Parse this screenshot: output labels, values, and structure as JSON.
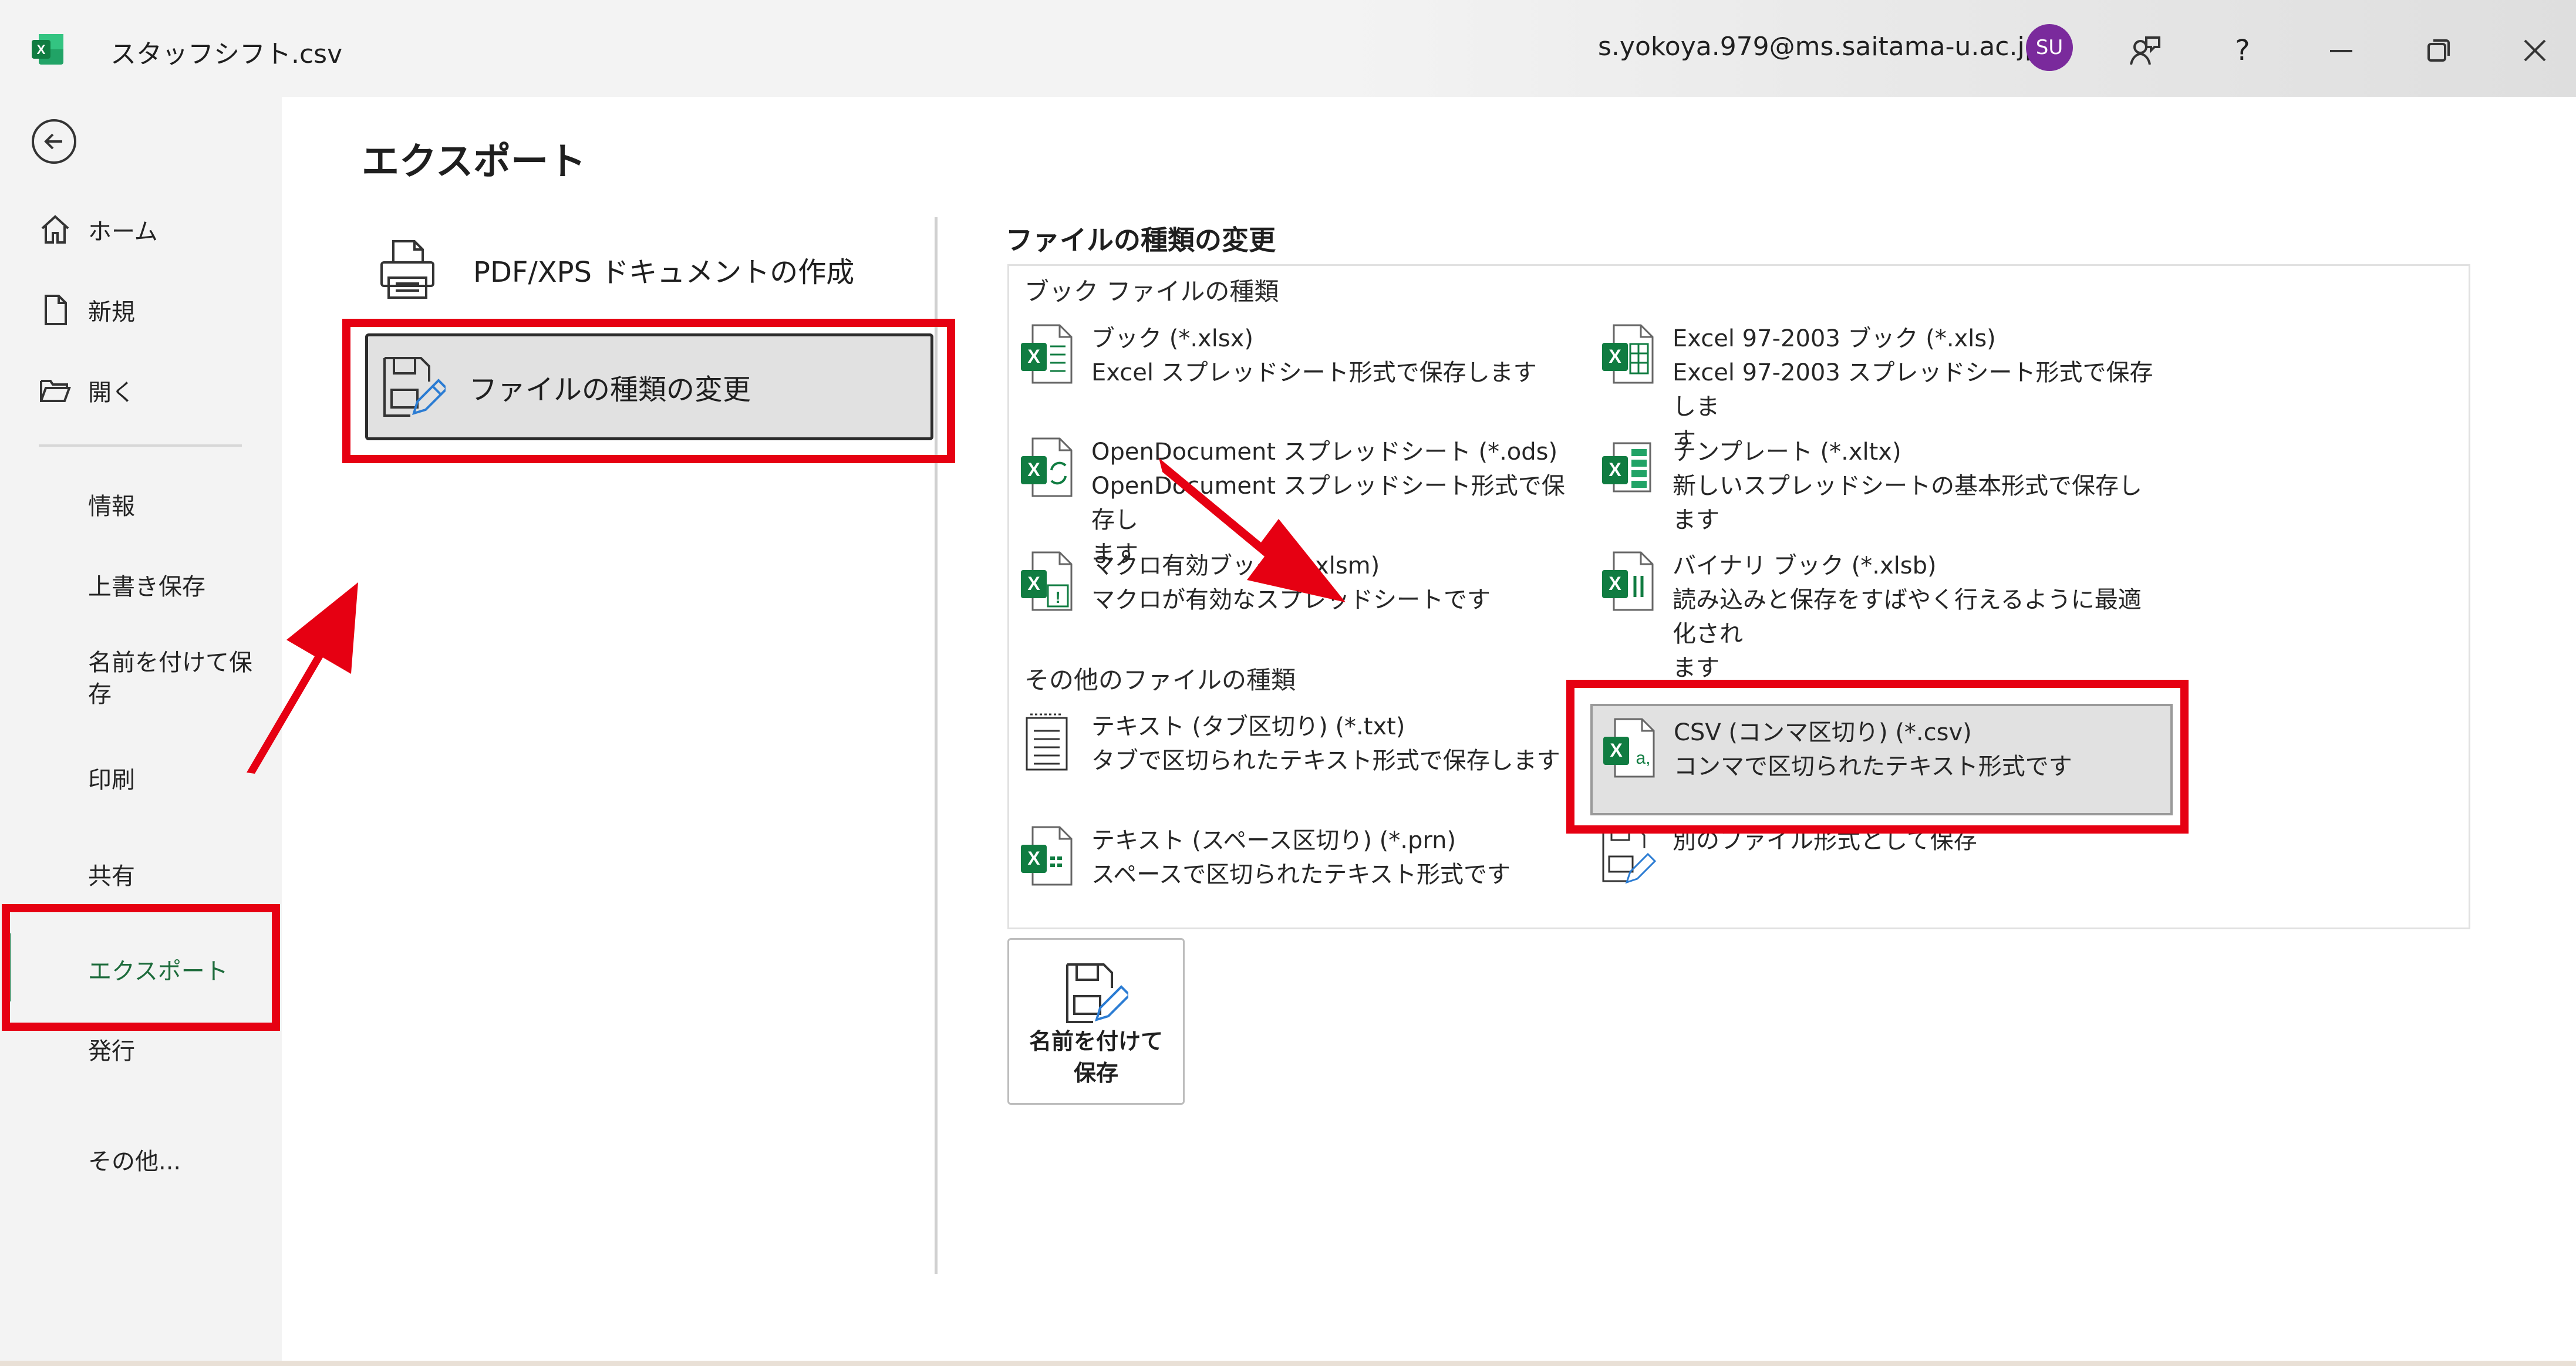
{
  "window": {
    "file_name": "スタッフシフト.csv",
    "account": "s.yokoya.979@ms.saitama-u.ac.jp",
    "avatar_initials": "SU",
    "help_label": "?"
  },
  "nav": {
    "items_top": [
      {
        "label": "ホーム",
        "icon": "home-icon"
      },
      {
        "label": "新規",
        "icon": "new-document-icon"
      },
      {
        "label": "開く",
        "icon": "folder-open-icon"
      }
    ],
    "items_bottom": [
      {
        "label": "情報"
      },
      {
        "label": "上書き保存"
      },
      {
        "label": "名前を付けて保\n存"
      },
      {
        "label": "印刷"
      },
      {
        "label": "共有"
      },
      {
        "label": "エクスポート",
        "active": true
      },
      {
        "label": "発行"
      },
      {
        "label": "その他..."
      }
    ]
  },
  "main": {
    "title": "エクスポート",
    "export_options": [
      {
        "label": "PDF/XPS ドキュメントの作成",
        "icon": "pdf-xps-icon"
      },
      {
        "label": "ファイルの種類の変更",
        "icon": "change-file-type-icon",
        "selected": true
      }
    ],
    "change_type": {
      "section_title": "ファイルの種類の変更",
      "workbook_group_title": "ブック ファイルの種類",
      "workbook_types": [
        {
          "name": "ブック (*.xlsx)",
          "desc": "Excel スプレッドシート形式で保存します",
          "icon": "xlsx-icon"
        },
        {
          "name": "Excel 97-2003 ブック (*.xls)",
          "desc": "Excel 97-2003 スプレッドシート形式で保存しま\nす",
          "icon": "xls-icon"
        },
        {
          "name": "OpenDocument スプレッドシート (*.ods)",
          "desc": "OpenDocument スプレッドシート形式で保存し\nます",
          "icon": "ods-icon"
        },
        {
          "name": "テンプレート (*.xltx)",
          "desc": "新しいスプレッドシートの基本形式で保存します",
          "icon": "xltx-icon"
        },
        {
          "name": "マクロ有効ブック (*.xlsm)",
          "desc": "マクロが有効なスプレッドシートです",
          "icon": "xlsm-icon"
        },
        {
          "name": "バイナリ ブック (*.xlsb)",
          "desc": "読み込みと保存をすばやく行えるように最適化され\nます",
          "icon": "xlsb-icon"
        }
      ],
      "other_group_title": "その他のファイルの種類",
      "other_types": [
        {
          "name": "テキスト (タブ区切り) (*.txt)",
          "desc": "タブで区切られたテキスト形式で保存します",
          "icon": "txt-icon"
        },
        {
          "name": "CSV (コンマ区切り) (*.csv)",
          "desc": "コンマで区切られたテキスト形式です",
          "icon": "csv-icon",
          "selected": true
        },
        {
          "name": "テキスト (スペース区切り) (*.prn)",
          "desc": "スペースで区切られたテキスト形式です",
          "icon": "prn-icon"
        },
        {
          "name": "別のファイル形式として保存",
          "desc": "",
          "icon": "other-format-icon"
        }
      ],
      "save_as_button": "名前を付けて\n保存"
    }
  },
  "colors": {
    "highlight": "#e60012",
    "excel_green": "#1e6c3c",
    "active_nav_text": "#1e6c3c",
    "avatar_bg": "#7a2a9c"
  }
}
